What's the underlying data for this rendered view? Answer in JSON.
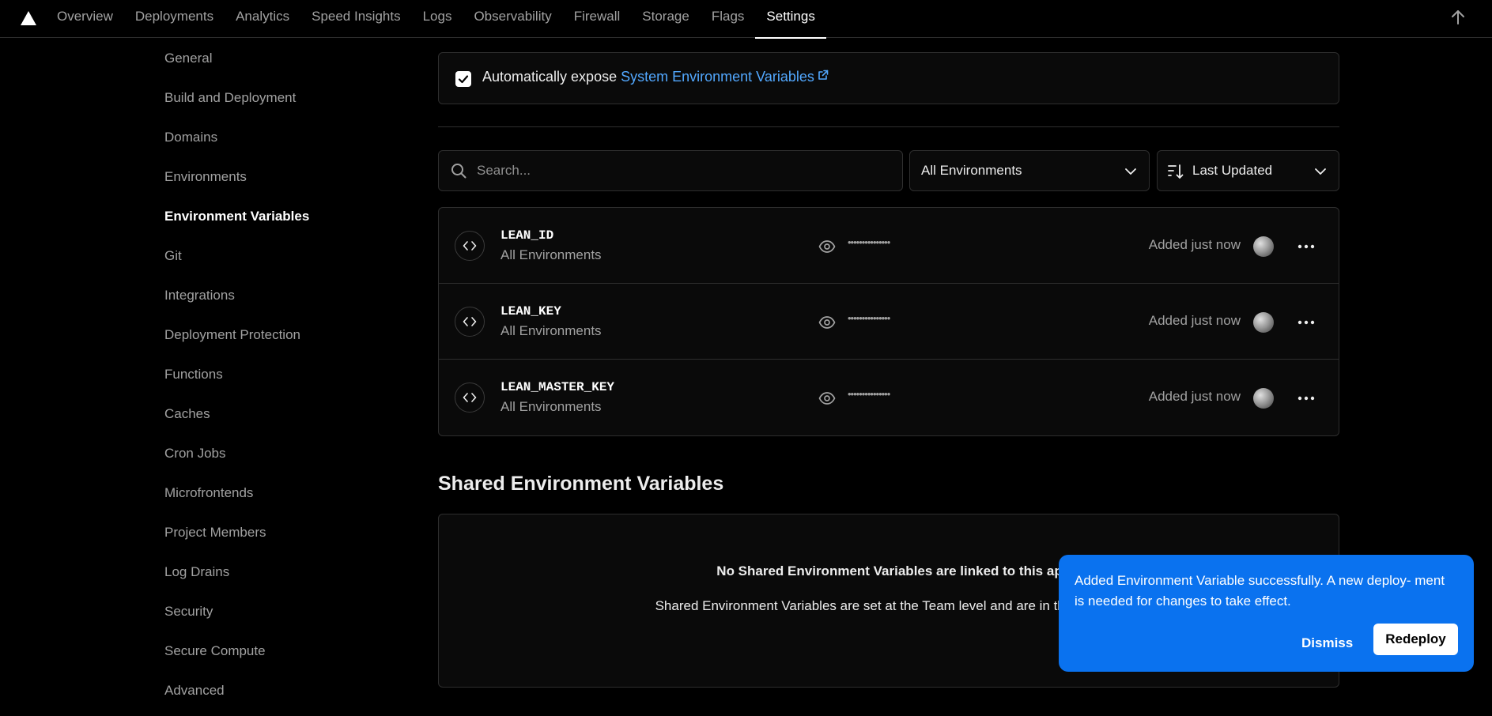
{
  "nav": {
    "tabs": [
      {
        "label": "Overview"
      },
      {
        "label": "Deployments"
      },
      {
        "label": "Analytics"
      },
      {
        "label": "Speed Insights"
      },
      {
        "label": "Logs"
      },
      {
        "label": "Observability"
      },
      {
        "label": "Firewall"
      },
      {
        "label": "Storage"
      },
      {
        "label": "Flags"
      },
      {
        "label": "Settings"
      }
    ],
    "active_tab": "Settings",
    "logo_icon": "triangle-logo-icon",
    "right_icon": "arrow-up-icon"
  },
  "sidebar": {
    "items": [
      {
        "label": "General"
      },
      {
        "label": "Build and Deployment"
      },
      {
        "label": "Domains"
      },
      {
        "label": "Environments"
      },
      {
        "label": "Environment Variables"
      },
      {
        "label": "Git"
      },
      {
        "label": "Integrations"
      },
      {
        "label": "Deployment Protection"
      },
      {
        "label": "Functions"
      },
      {
        "label": "Caches"
      },
      {
        "label": "Cron Jobs"
      },
      {
        "label": "Microfrontends"
      },
      {
        "label": "Project Members"
      },
      {
        "label": "Log Drains"
      },
      {
        "label": "Security"
      },
      {
        "label": "Secure Compute"
      },
      {
        "label": "Advanced"
      }
    ],
    "active_item": "Environment Variables"
  },
  "expose": {
    "checked": true,
    "prefix": "Automatically expose",
    "link_label": "System Environment Variables"
  },
  "filters": {
    "search_placeholder": "Search...",
    "environment": "All Environments",
    "sort": "Last Updated"
  },
  "variables": [
    {
      "name": "LEAN_ID",
      "environments": "All Environments",
      "value": "•••••••••••••••",
      "updated": "Added just now"
    },
    {
      "name": "LEAN_KEY",
      "environments": "All Environments",
      "value": "•••••••••••••••",
      "updated": "Added just now"
    },
    {
      "name": "LEAN_MASTER_KEY",
      "environments": "All Environments",
      "value": "•••••••••••••••",
      "updated": "Added just now"
    }
  ],
  "shared": {
    "title": "Shared Environment Variables",
    "empty_title": "No Shared Environment Variables are linked to this ap",
    "empty_desc": "Shared Environment Variables are set at the Team level and are in this Project."
  },
  "toast": {
    "message": "Added Environment Variable successfully. A new deploy- ment is needed for changes to take effect.",
    "dismiss_label": "Dismiss",
    "redeploy_label": "Redeploy",
    "color": "#0a72ef"
  },
  "colors": {
    "background": "#000000",
    "link": "#52a8ff",
    "border": "#2e2e2e"
  }
}
